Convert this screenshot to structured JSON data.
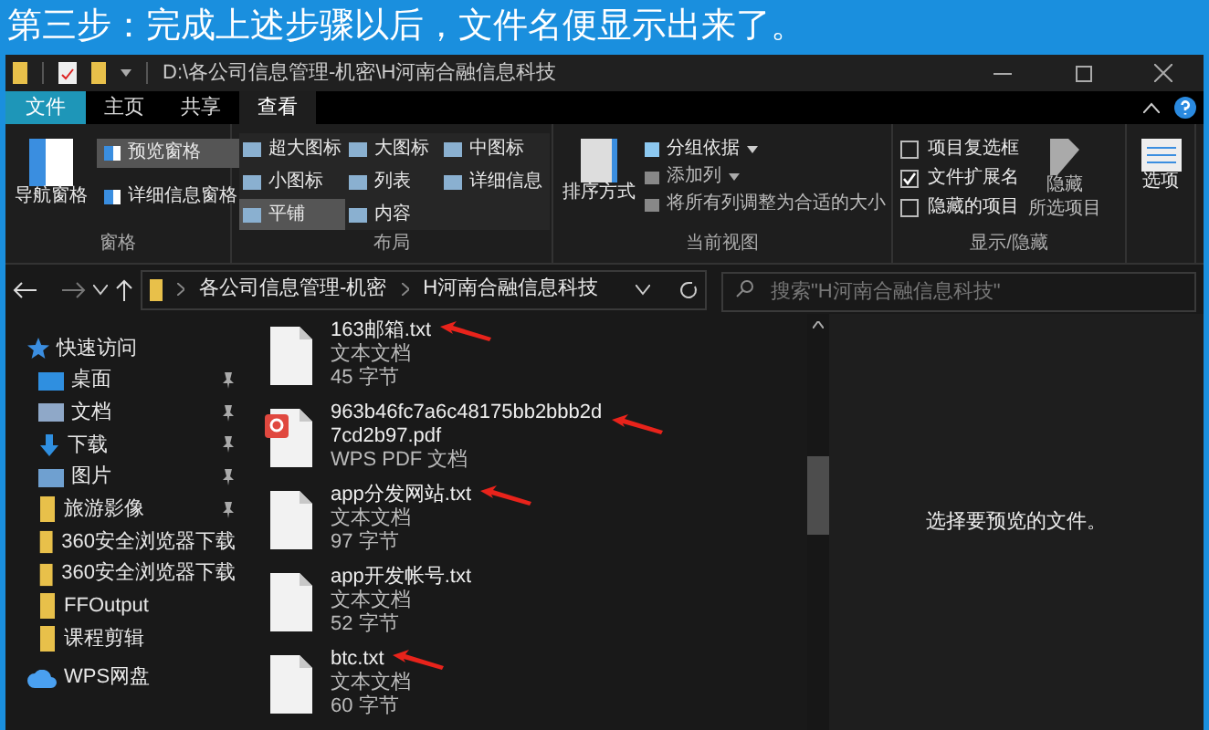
{
  "banner": {
    "title": "第三步：完成上述步骤以后，文件名便显示出来了。"
  },
  "window": {
    "title": "D:\\各公司信息管理-机密\\H河南合融信息科技"
  },
  "tabs": [
    {
      "label": "文件",
      "kind": "file",
      "selected": false
    },
    {
      "label": "主页",
      "kind": "tab",
      "selected": false
    },
    {
      "label": "共享",
      "kind": "tab",
      "selected": false
    },
    {
      "label": "查看",
      "kind": "tab",
      "selected": true
    }
  ],
  "ribbon": {
    "panes": {
      "nav_pane": "导航窗格",
      "preview_pane": {
        "label": "预览窗格",
        "selected": true
      },
      "details_pane": {
        "label": "详细信息窗格",
        "selected": false
      },
      "group": "窗格"
    },
    "layout": {
      "options": [
        {
          "label": "超大图标",
          "selected": false
        },
        {
          "label": "大图标",
          "selected": false
        },
        {
          "label": "中图标",
          "selected": false
        },
        {
          "label": "小图标",
          "selected": false
        },
        {
          "label": "列表",
          "selected": false
        },
        {
          "label": "详细信息",
          "selected": false
        },
        {
          "label": "平铺",
          "selected": true
        },
        {
          "label": "内容",
          "selected": false
        }
      ],
      "group": "布局"
    },
    "current_view": {
      "sort": "排序方式",
      "group_by": "分组依据",
      "add_column": "添加列",
      "fit_columns": "将所有列调整为合适的大小",
      "group": "当前视图"
    },
    "show_hide": {
      "checkboxes": [
        {
          "label": "项目复选框",
          "checked": false
        },
        {
          "label": "文件扩展名",
          "checked": true
        },
        {
          "label": "隐藏的项目",
          "checked": false
        }
      ],
      "hide_selected": [
        "隐藏",
        "所选项目"
      ],
      "group": "显示/隐藏"
    },
    "options": "选项"
  },
  "address": {
    "crumbs": [
      "各公司信息管理-机密",
      "H河南合融信息科技"
    ],
    "search_placeholder": "搜索\"H河南合融信息科技\""
  },
  "sidebar": {
    "items": [
      {
        "label": "快速访问",
        "kind": "quick",
        "pinned": false
      },
      {
        "label": "桌面",
        "kind": "desktop",
        "pinned": true
      },
      {
        "label": "文档",
        "kind": "docs",
        "pinned": true
      },
      {
        "label": "下载",
        "kind": "download",
        "pinned": true
      },
      {
        "label": "图片",
        "kind": "pictures",
        "pinned": true
      },
      {
        "label": "旅游影像",
        "kind": "folder",
        "pinned": true
      },
      {
        "label": "360安全浏览器下载",
        "kind": "folder",
        "pinned": false
      },
      {
        "label": "360安全浏览器下载",
        "kind": "folder",
        "pinned": false
      },
      {
        "label": "FFOutput",
        "kind": "folder",
        "pinned": false
      },
      {
        "label": "课程剪辑",
        "kind": "folder",
        "pinned": false
      },
      {
        "label": "WPS网盘",
        "kind": "cloud",
        "pinned": false
      }
    ]
  },
  "files": [
    {
      "name": "163邮箱.txt",
      "type": "文本文档",
      "size": "45 字节",
      "kind": "txt",
      "marked": true
    },
    {
      "name": "963b46fc7a6c48175bb2bbb2d\n7cd2b97.pdf",
      "type": "WPS PDF 文档",
      "kind": "pdf",
      "marked": true
    },
    {
      "name": "app分发网站.txt",
      "type": "文本文档",
      "size": "97 字节",
      "kind": "txt",
      "marked": true
    },
    {
      "name": "app开发帐号.txt",
      "type": "文本文档",
      "size": "52 字节",
      "kind": "txt",
      "marked": false
    },
    {
      "name": "btc.txt",
      "type": "文本文档",
      "size": "60 字节",
      "kind": "txt",
      "marked": true
    }
  ],
  "preview": {
    "message": "选择要预览的文件。"
  }
}
